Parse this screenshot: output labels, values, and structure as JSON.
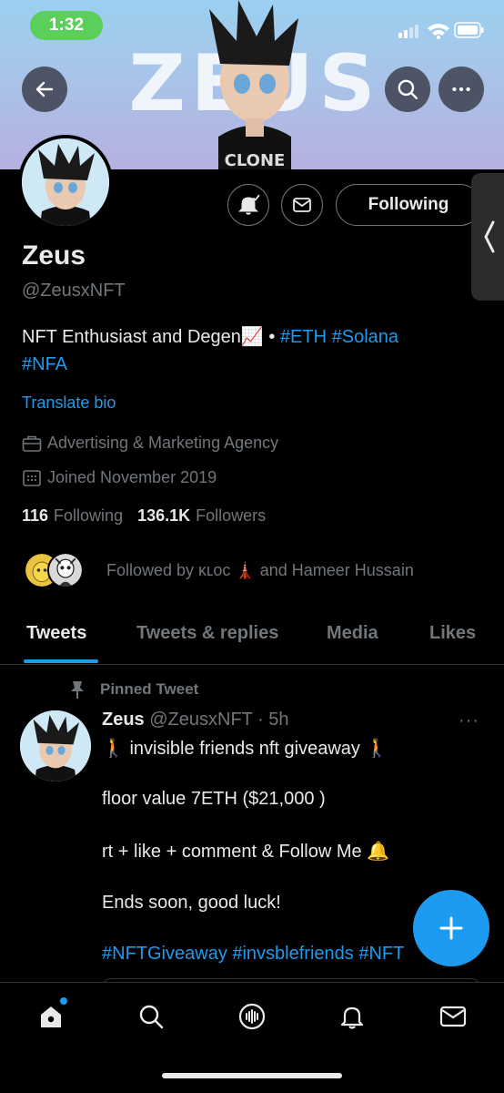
{
  "status_bar": {
    "time": "1:32"
  },
  "banner": {
    "title": "ZEUS",
    "shirt_text": "CLONE"
  },
  "profile": {
    "name": "Zeus",
    "handle": "@ZeusxNFT",
    "bio_text": "NFT Enthusiast and Degen",
    "bio_emoji": "📈",
    "bio_separator": " • ",
    "bio_tags": [
      "#ETH",
      "#Solana",
      "#NFA"
    ],
    "translate_label": "Translate bio",
    "category": "Advertising & Marketing Agency",
    "joined": "Joined November 2019",
    "following_count": "116",
    "following_label": "Following",
    "followers_count": "136.1K",
    "followers_label": "Followers",
    "followed_by": "Followed by ᴋʟᴏᴄ 🗼 and Hameer Hussain",
    "following_button": "Following"
  },
  "tabs": [
    "Tweets",
    "Tweets & replies",
    "Media",
    "Likes"
  ],
  "active_tab": "Tweets",
  "tweet": {
    "pinned_label": "Pinned Tweet",
    "author": "Zeus",
    "handle_time": "@ZeusxNFT · 5h",
    "more": "···",
    "lines": [
      "🚶 invisible friends nft giveaway 🚶",
      "floor value 7ETH ($21,000 )",
      "rt + like + comment & Follow Me 🔔",
      "Ends soon, good luck!"
    ],
    "tags": "#NFTGiveaway #invsblefriends #NFT"
  },
  "colors": {
    "accent": "#1d9bf0",
    "background": "#000000",
    "text": "#e7e9ea",
    "muted": "#71767b",
    "status_pill": "#5ad05a"
  },
  "icons": {
    "back": "arrow-left-icon",
    "search": "search-icon",
    "more": "more-icon",
    "notifications": "bell-icon",
    "message": "envelope-icon",
    "compose": "plus-icon",
    "nav": [
      "home-icon",
      "search-icon",
      "spaces-icon",
      "bell-icon",
      "envelope-icon"
    ]
  }
}
